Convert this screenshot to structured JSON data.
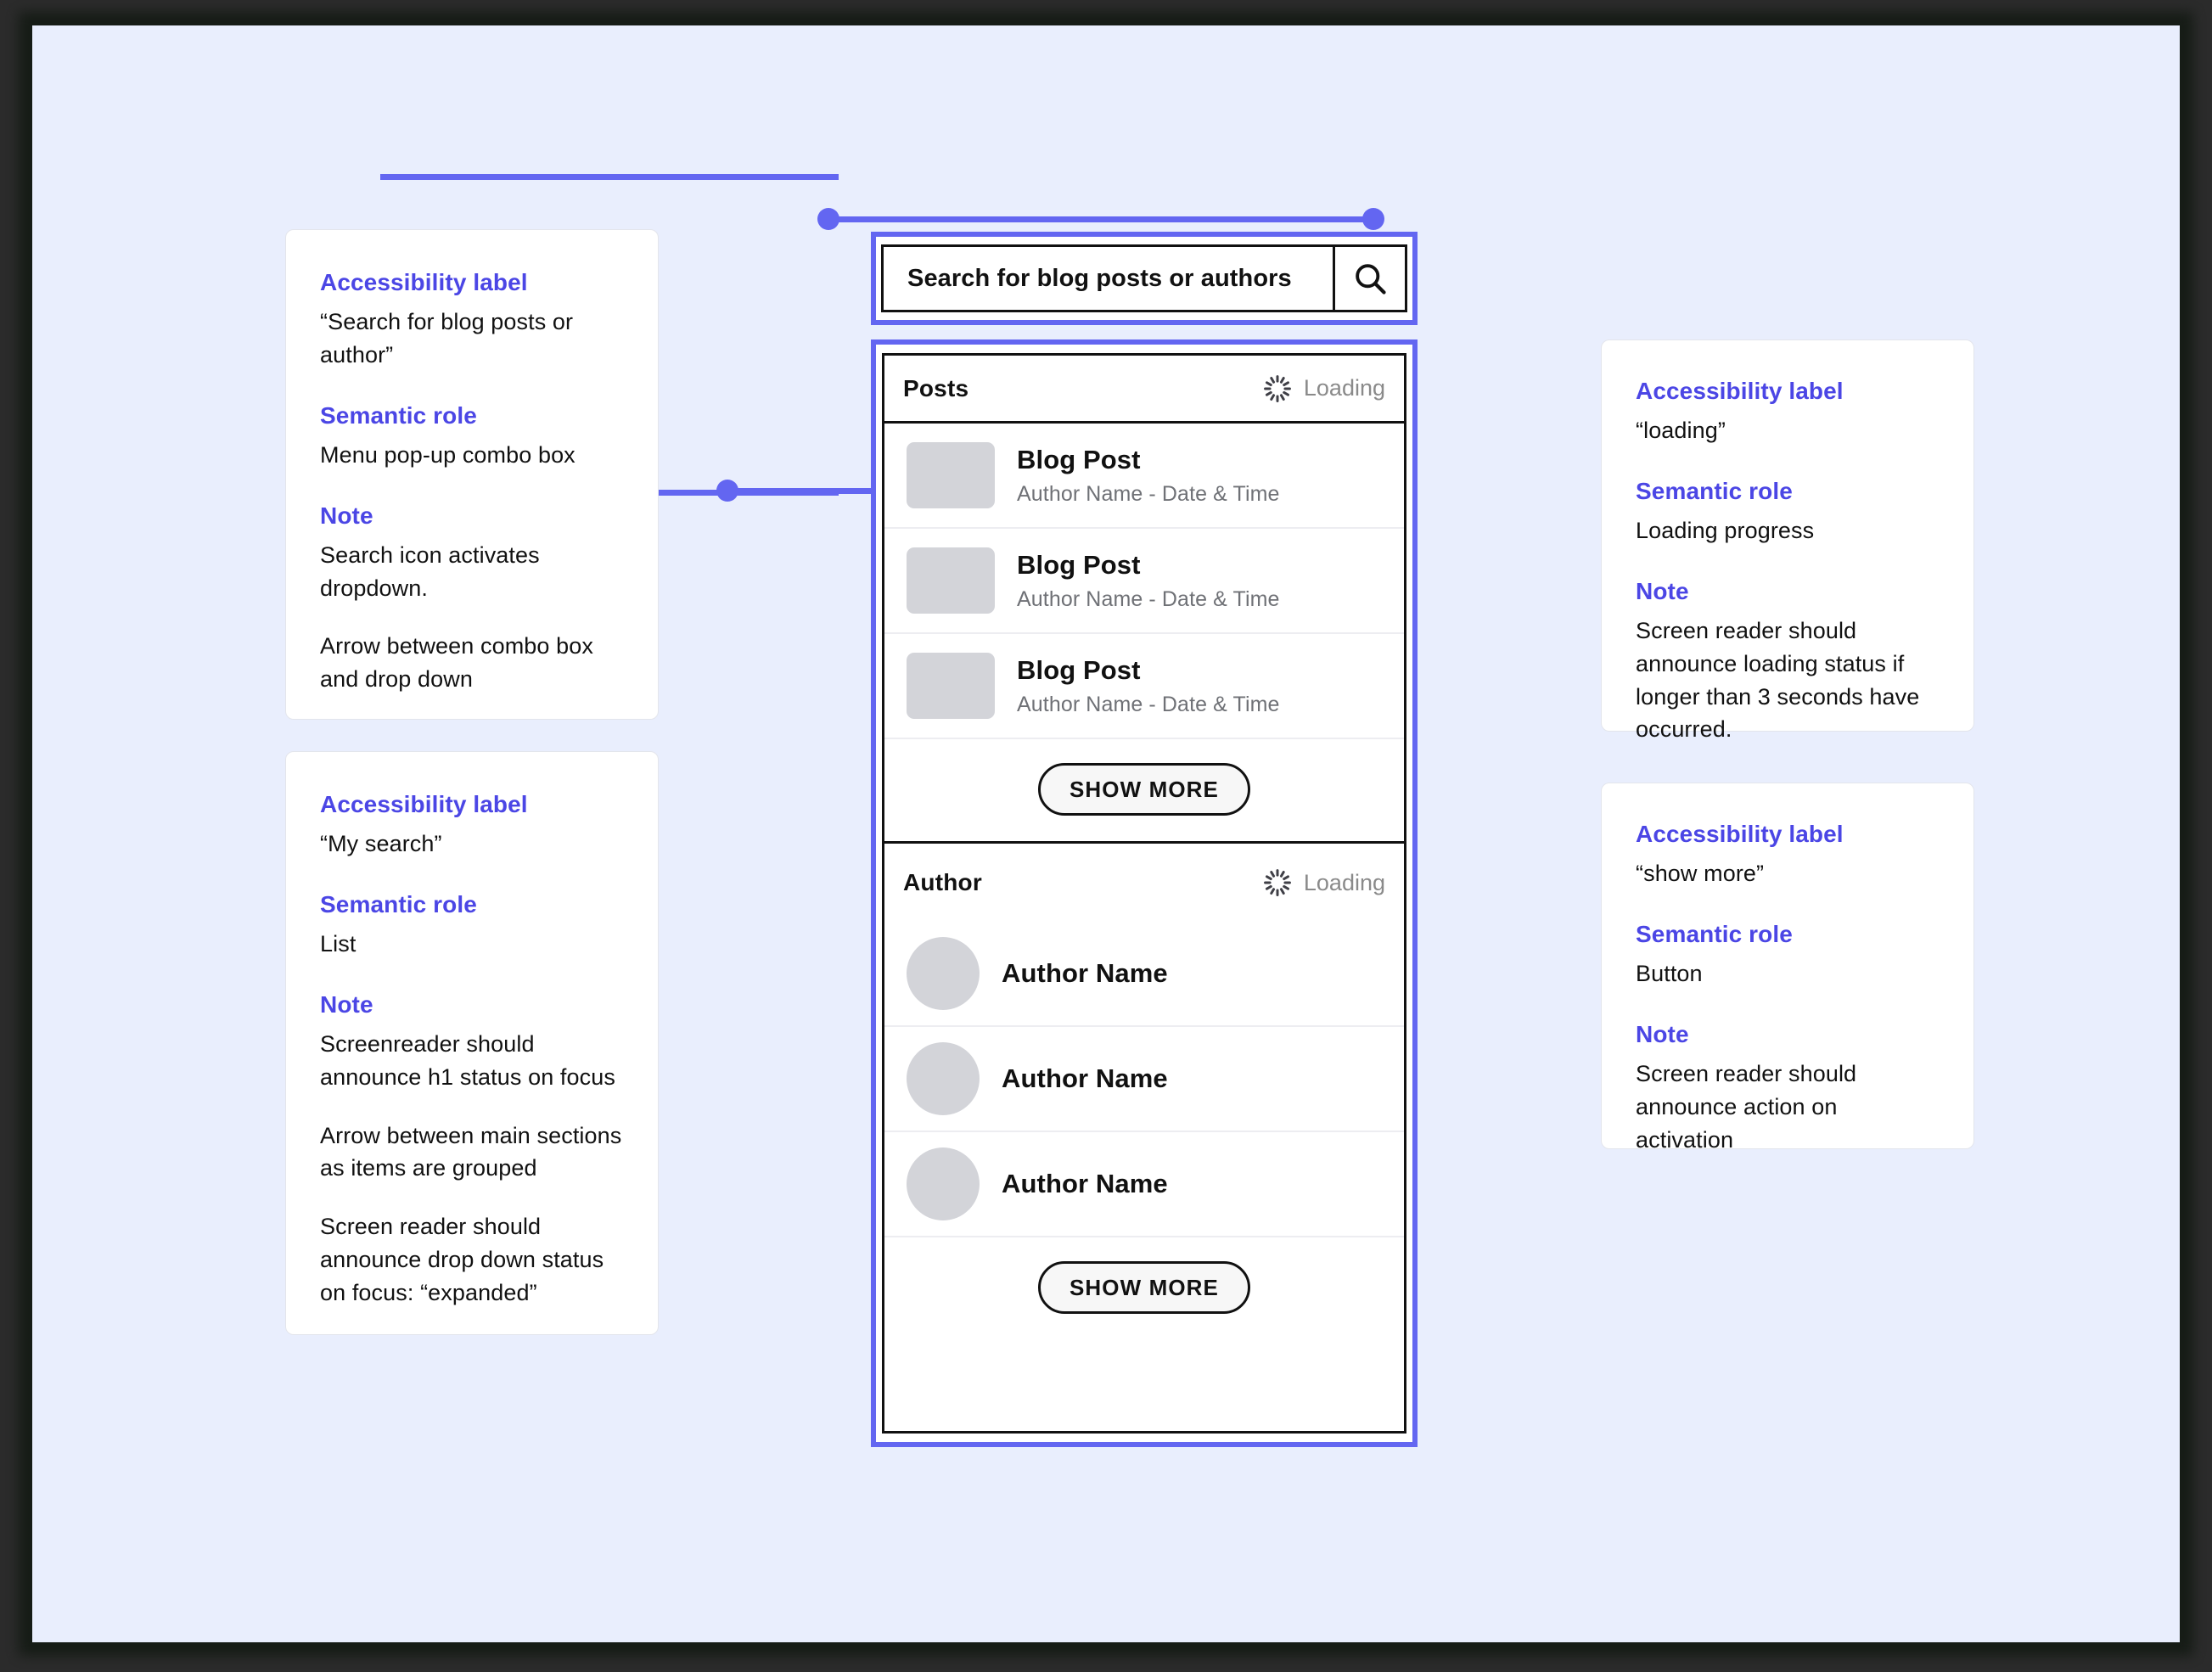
{
  "theme": {
    "canvas_bg": "#e9eefd",
    "accent": "#6366f1",
    "label_color": "#4b46e5",
    "placeholder_gray": "#d3d4d9"
  },
  "search": {
    "label": "Search for blog posts or authors",
    "icon": "search-icon"
  },
  "panel": {
    "posts": {
      "title": "Posts",
      "loading_label": "Loading",
      "spinner_icon": "spinner-icon",
      "items": [
        {
          "title": "Blog Post",
          "meta": "Author Name - Date & Time"
        },
        {
          "title": "Blog Post",
          "meta": "Author Name - Date & Time"
        },
        {
          "title": "Blog Post",
          "meta": "Author Name - Date & Time"
        }
      ],
      "show_more": "SHOW MORE"
    },
    "author": {
      "title": "Author",
      "loading_label": "Loading",
      "spinner_icon": "spinner-icon",
      "items": [
        {
          "name": "Author Name"
        },
        {
          "name": "Author Name"
        },
        {
          "name": "Author Name"
        }
      ],
      "show_more": "SHOW MORE"
    }
  },
  "annotations": {
    "search": {
      "h1": "Accessibility label",
      "p1": "“Search for blog posts or author”",
      "h2": "Semantic role",
      "p2": "Menu pop-up combo box",
      "h3": "Note",
      "p3": "Search icon activates dropdown.",
      "p4": "Arrow between combo box and drop down"
    },
    "list": {
      "h1": "Accessibility label",
      "p1": "“My search”",
      "h2": "Semantic role",
      "p2": "List",
      "h3": "Note",
      "p3": "Screenreader should announce h1 status on focus",
      "p4": "Arrow between main sections as items are grouped",
      "p5": "Screen reader should announce drop down status on focus: “expanded”"
    },
    "loading": {
      "h1": "Accessibility label",
      "p1": "“loading”",
      "h2": "Semantic role",
      "p2": "Loading progress",
      "h3": "Note",
      "p3": "Screen reader should announce loading status if longer than 3 seconds have occurred."
    },
    "showmore": {
      "h1": "Accessibility label",
      "p1": "“show more”",
      "h2": "Semantic role",
      "p2": "Button",
      "h3": "Note",
      "p3": "Screen reader should announce action on activation"
    }
  }
}
